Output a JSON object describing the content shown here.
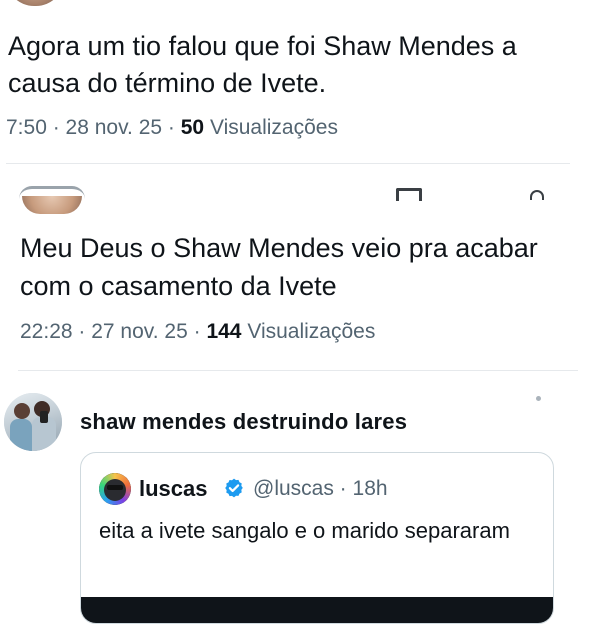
{
  "tweet1": {
    "text": "Agora um tio falou que foi Shaw Mendes a causa do término de Ivete.",
    "time": "7:50",
    "sep1": " · ",
    "date": "28 nov. 25",
    "sep2": " · ",
    "views_count": "50",
    "views_label": " Visualizações"
  },
  "tweet2": {
    "text": "Meu Deus o Shaw Mendes veio pra acabar com o casamento da Ivete",
    "time": "22:28",
    "sep1": " · ",
    "date": "27 nov. 25",
    "sep2": " · ",
    "views_count": "144",
    "views_label": " Visualizações"
  },
  "tweet3": {
    "text": "shaw mendes destruindo lares"
  },
  "quote": {
    "name": "luscas",
    "handle": "@luscas",
    "sep": " · ",
    "age": "18h",
    "text": "eita a ivete sangalo e o marido separaram",
    "verified_color": "#1d9bf0"
  },
  "icons": {
    "verified": "verified-badge-icon",
    "more": "more-dot-icon"
  },
  "colors": {
    "text": "#0f1419",
    "muted": "#536471",
    "divider": "#e6e9ec"
  }
}
